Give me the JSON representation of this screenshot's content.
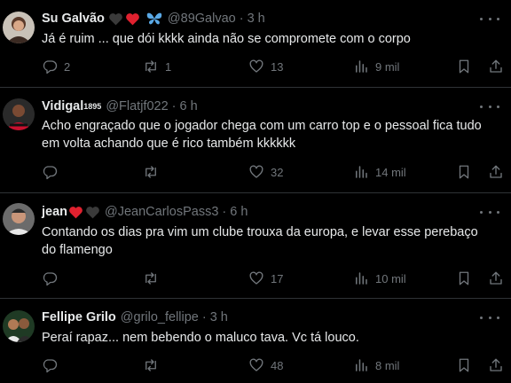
{
  "tweets": [
    {
      "name": "Su Galvão",
      "handle": "@89Galvao",
      "sep": "·",
      "time": "3 h",
      "text": "Já é ruim ... que dói kkkk ainda não se compromete com o corpo",
      "replies": "2",
      "retweets": "1",
      "likes": "13",
      "views": "9 mil",
      "emoji": [
        "black-heart",
        "red-heart",
        "blue-butterfly"
      ]
    },
    {
      "name": "Vidigal",
      "name_sup": "1895",
      "handle": "@Flatjf022",
      "sep": "·",
      "time": "6 h",
      "text": "Acho engraçado que o jogador chega com um carro top e o pessoal fica tudo em volta achando que é rico também kkkkkk",
      "replies": "",
      "retweets": "",
      "likes": "32",
      "views": "14 mil"
    },
    {
      "name": "jean",
      "handle": "@JeanCarlosPass3",
      "sep": "·",
      "time": "6 h",
      "text": "Contando os dias pra vim um clube trouxa da europa, e levar esse perebaço do flamengo",
      "replies": "",
      "retweets": "",
      "likes": "17",
      "views": "10 mil",
      "emoji": [
        "red-heart",
        "black-heart"
      ]
    },
    {
      "name": "Fellipe Grilo",
      "handle": "@grilo_fellipe",
      "sep": "·",
      "time": "3 h",
      "text": "Peraí rapaz... nem bebendo o maluco tava. Vc tá louco.",
      "replies": "",
      "retweets": "",
      "likes": "48",
      "views": "8 mil"
    }
  ],
  "colors": {
    "background": "#000000",
    "text": "#e7e9ea",
    "muted": "#71767b",
    "divider": "#2f3336",
    "heart_red": "#f91880"
  }
}
